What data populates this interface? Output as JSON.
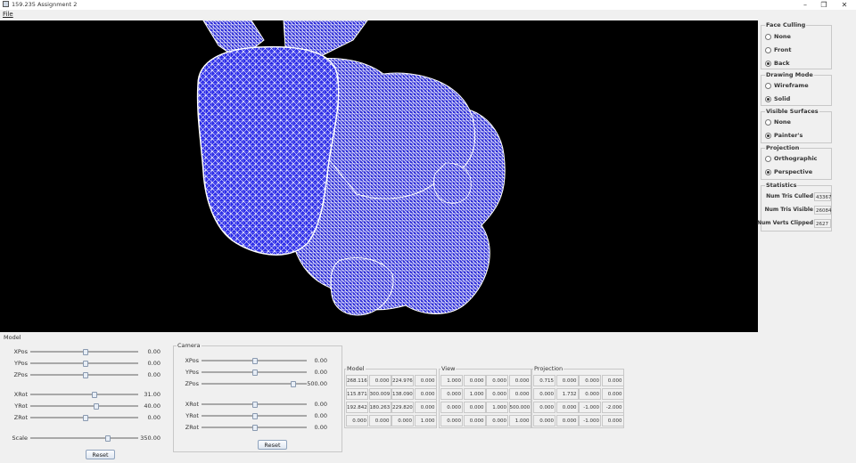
{
  "window": {
    "title": "159.235 Assignment 2",
    "minimize": "–",
    "maximize": "❐",
    "close": "✕"
  },
  "menu": {
    "file": "File"
  },
  "viewport": {
    "background": "#000000",
    "mesh_fill": "#2323e6",
    "mesh_line": "#ffffff",
    "content": "3D bunny mesh render"
  },
  "side": {
    "face_culling": {
      "title": "Face Culling",
      "options": [
        "None",
        "Front",
        "Back"
      ],
      "selected": 2
    },
    "drawing_mode": {
      "title": "Drawing Mode",
      "options": [
        "Wireframe",
        "Solid"
      ],
      "selected": 1
    },
    "visible_surfaces": {
      "title": "Visible Surfaces",
      "options": [
        "None",
        "Painter's"
      ],
      "selected": 1
    },
    "projection": {
      "title": "Projection",
      "options": [
        "Orthographic",
        "Perspective"
      ],
      "selected": 1
    },
    "statistics": {
      "title": "Statistics",
      "rows": [
        {
          "label": "Num Tris Culled",
          "value": "43367"
        },
        {
          "label": "Num Tris Visible",
          "value": "26084"
        },
        {
          "label": "Num Verts Clipped",
          "value": "2627"
        }
      ]
    }
  },
  "model": {
    "title": "Model",
    "sliders": [
      {
        "label": "XPos",
        "value": "0.00",
        "level": 0.5
      },
      {
        "label": "YPos",
        "value": "0.00",
        "level": 0.5
      },
      {
        "label": "ZPos",
        "value": "0.00",
        "level": 0.5
      },
      {
        "label": "XRot",
        "value": "31.00",
        "level": 0.59
      },
      {
        "label": "YRot",
        "value": "40.00",
        "level": 0.61
      },
      {
        "label": "ZRot",
        "value": "0.00",
        "level": 0.5
      },
      {
        "label": "Scale",
        "value": "350.00",
        "level": 0.72
      }
    ],
    "reset": "Reset"
  },
  "camera": {
    "title": "Camera",
    "sliders": [
      {
        "label": "XPos",
        "value": "0.00",
        "level": 0.5
      },
      {
        "label": "YPos",
        "value": "0.00",
        "level": 0.5
      },
      {
        "label": "ZPos",
        "value": "500.00",
        "level": 0.88
      },
      {
        "label": "XRot",
        "value": "0.00",
        "level": 0.5
      },
      {
        "label": "YRot",
        "value": "0.00",
        "level": 0.5
      },
      {
        "label": "ZRot",
        "value": "0.00",
        "level": 0.5
      }
    ],
    "reset": "Reset"
  },
  "matrices": [
    {
      "title": "Model",
      "rows": [
        [
          "268.116",
          "0.000",
          "224.976",
          "0.000"
        ],
        [
          "115.871",
          "300.009",
          "138.090",
          "0.000"
        ],
        [
          "192.842",
          "180.263",
          "229.820",
          "0.000"
        ],
        [
          "0.000",
          "0.000",
          "0.000",
          "1.000"
        ]
      ]
    },
    {
      "title": "View",
      "rows": [
        [
          "1.000",
          "0.000",
          "0.000",
          "0.000"
        ],
        [
          "0.000",
          "1.000",
          "0.000",
          "0.000"
        ],
        [
          "0.000",
          "0.000",
          "1.000",
          "500.000"
        ],
        [
          "0.000",
          "0.000",
          "0.000",
          "1.000"
        ]
      ]
    },
    {
      "title": "Projection",
      "rows": [
        [
          "0.715",
          "0.000",
          "0.000",
          "0.000"
        ],
        [
          "0.000",
          "1.732",
          "0.000",
          "0.000"
        ],
        [
          "0.000",
          "0.000",
          "-1.000",
          "-2.000"
        ],
        [
          "0.000",
          "0.000",
          "-1.000",
          "0.000"
        ]
      ]
    }
  ]
}
